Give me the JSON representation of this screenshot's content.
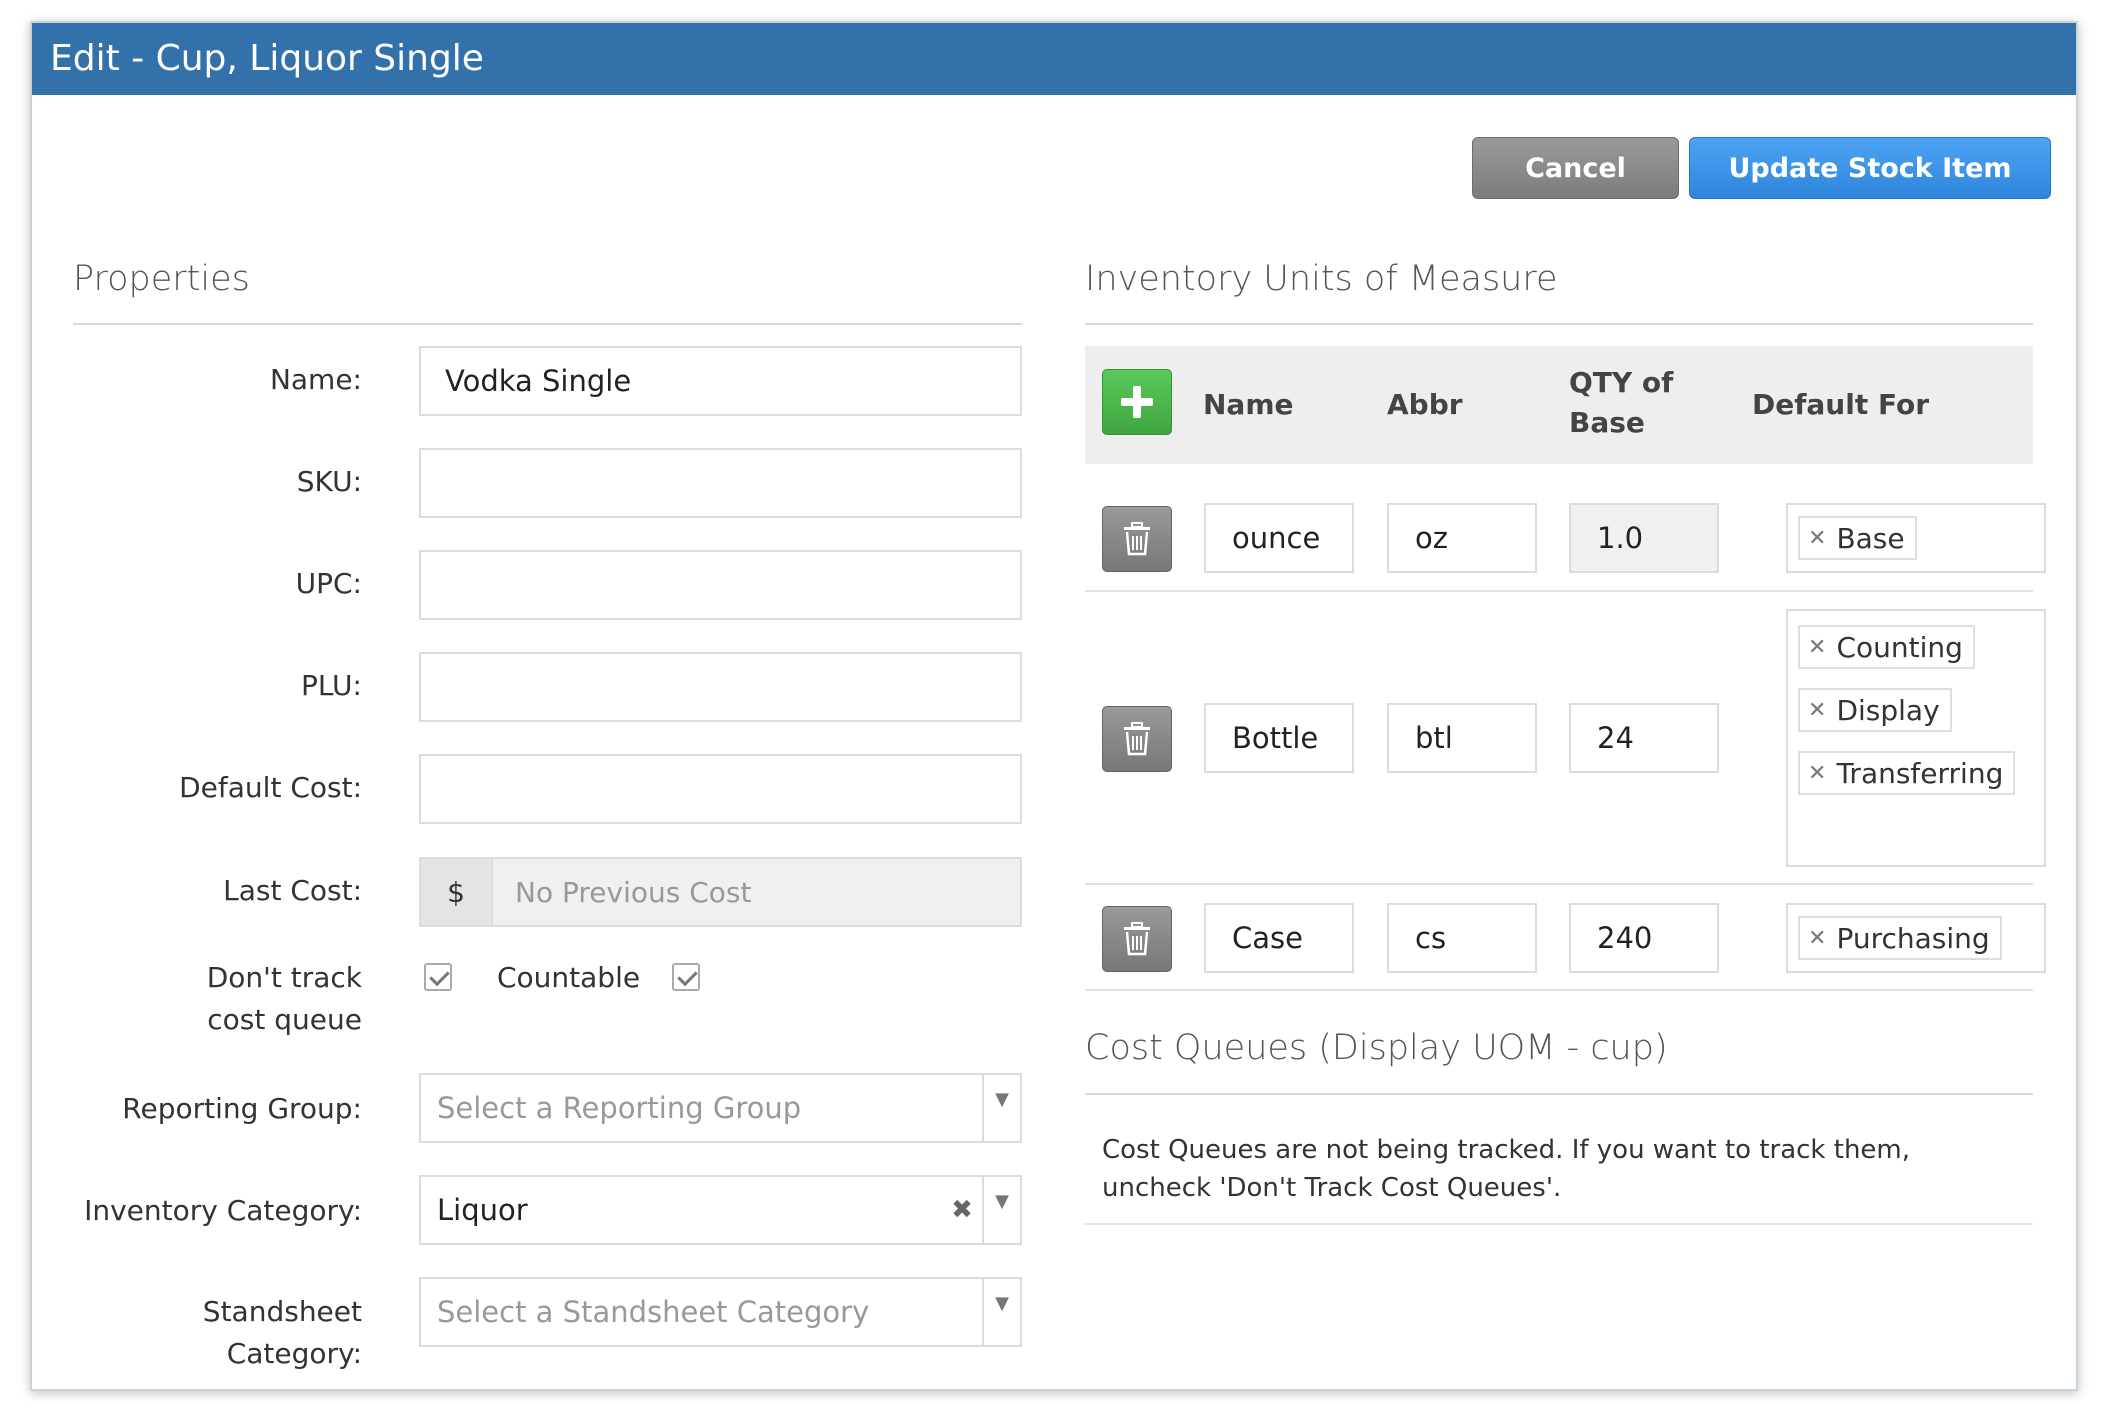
{
  "window": {
    "title": "Edit - Cup, Liquor Single"
  },
  "actions": {
    "cancel_label": "Cancel",
    "update_label": "Update Stock Item"
  },
  "properties": {
    "title": "Properties",
    "name_label": "Name:",
    "name_value": "Vodka Single",
    "sku_label": "SKU:",
    "sku_value": "",
    "upc_label": "UPC:",
    "upc_value": "",
    "plu_label": "PLU:",
    "plu_value": "",
    "default_cost_label": "Default Cost:",
    "default_cost_value": "",
    "last_cost_label": "Last Cost:",
    "last_cost_addon": "$",
    "last_cost_value": "No Previous Cost",
    "dont_track_label": "Don't track cost queue",
    "dont_track_checked": true,
    "countable_label": "Countable",
    "countable_checked": true,
    "reporting_group_label": "Reporting Group:",
    "reporting_group_placeholder": "Select a Reporting Group",
    "inventory_category_label": "Inventory Category:",
    "inventory_category_value": "Liquor",
    "standsheet_category_label": "Standsheet Category:",
    "standsheet_category_placeholder": "Select a Standsheet Category"
  },
  "uom": {
    "title": "Inventory Units of Measure",
    "headers": {
      "name": "Name",
      "abbr": "Abbr",
      "qty": "QTY of Base",
      "default_for": "Default For"
    },
    "rows": [
      {
        "name": "ounce",
        "abbr": "oz",
        "qty": "1.0",
        "defaults": [
          "Base"
        ]
      },
      {
        "name": "Bottle",
        "abbr": "btl",
        "qty": "24",
        "defaults": [
          "Counting",
          "Display",
          "Transferring"
        ]
      },
      {
        "name": "Case",
        "abbr": "cs",
        "qty": "240",
        "defaults": [
          "Purchasing"
        ]
      }
    ]
  },
  "cost_queues": {
    "title": "Cost Queues (Display UOM - cup)",
    "message": "Cost Queues are not being tracked. If you want to track them, uncheck 'Don't Track Cost Queues'."
  },
  "icons": {
    "add": "plus-icon",
    "delete": "trash-icon",
    "remove_tag": "close-icon",
    "dropdown": "chevron-down-icon",
    "check": "check-icon"
  },
  "colors": {
    "titlebar": "#3371ab",
    "primary": "#3b8fe6",
    "success": "#4cb84c",
    "neutral": "#8a8a8a"
  }
}
